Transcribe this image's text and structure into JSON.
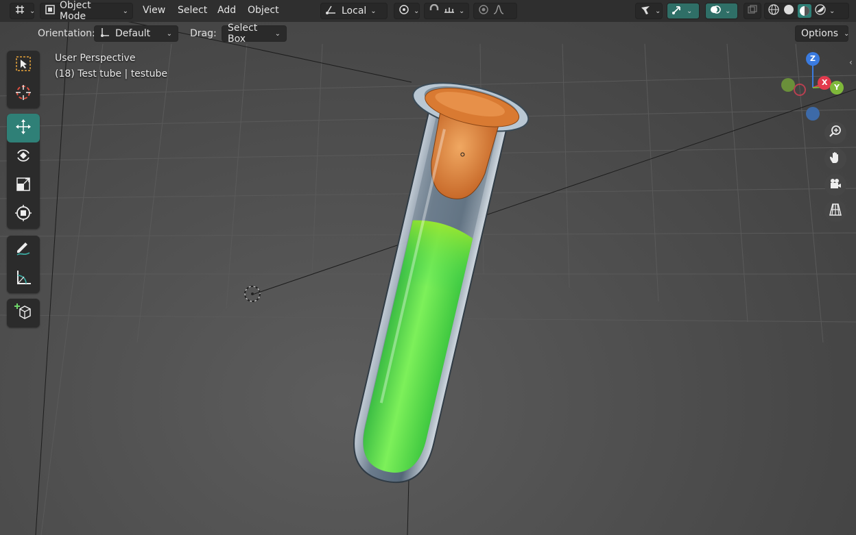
{
  "header": {
    "editor_type_icon": "grid-axes-icon",
    "mode_icon": "object-mode-icon",
    "mode_label": "Object Mode",
    "menus": [
      "View",
      "Select",
      "Add",
      "Object"
    ],
    "pivot_icon": "transform-pivot-icon",
    "pivot_label": "Local",
    "snap_icon": "magnet-icon",
    "proportional_icon": "proportional-falloff-icon"
  },
  "tool_settings": {
    "orientation_label": "Orientation:",
    "orientation_value": "Default",
    "drag_label": "Drag:",
    "drag_value": "Select Box",
    "options_label": "Options"
  },
  "viewport": {
    "view_name": "User Perspective",
    "object_info": "(18) Test tube | testube"
  },
  "gizmo": {
    "z_label": "Z",
    "x_label": "X",
    "y_label": "Y",
    "colors": {
      "x": "#e23a4d",
      "y": "#7fb83a",
      "z": "#3a7be0"
    }
  },
  "toolbar": {
    "tools": [
      "select-box-tool",
      "cursor-tool",
      "move-tool",
      "rotate-tool",
      "scale-tool",
      "transform-tool",
      "annotate-tool",
      "measure-tool",
      "add-cube-tool"
    ],
    "active_tool": "move-tool",
    "accent_color": "#2f8077"
  },
  "scene": {
    "liquid_color": "#4fdc4a",
    "stopper_color": "#e0843c"
  }
}
